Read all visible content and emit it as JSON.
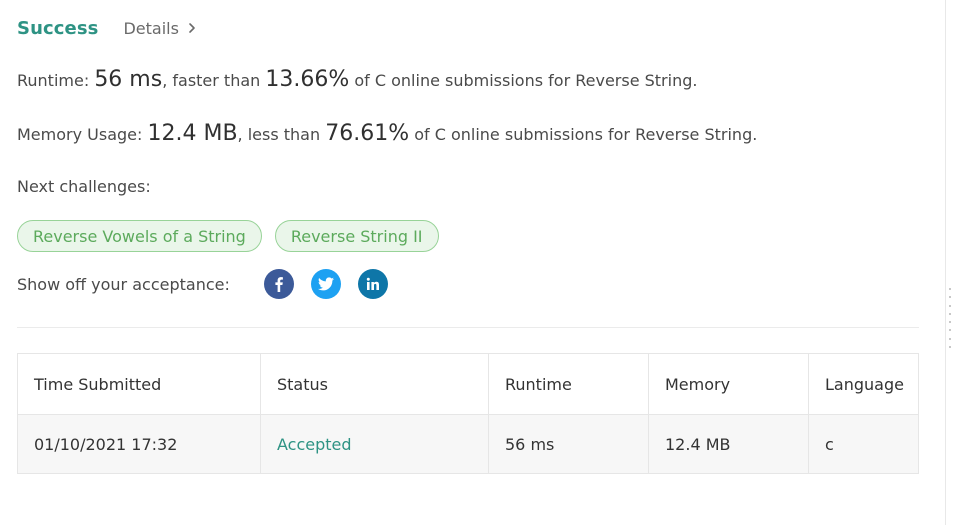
{
  "header": {
    "status": "Success",
    "details_label": "Details"
  },
  "runtime": {
    "prefix": "Runtime: ",
    "value": "56 ms",
    "mid": ", faster than ",
    "percent": "13.66%",
    "suffix": " of C online submissions for Reverse String."
  },
  "memory": {
    "prefix": "Memory Usage: ",
    "value": "12.4 MB",
    "mid": ", less than ",
    "percent": "76.61%",
    "suffix": " of C online submissions for Reverse String."
  },
  "next_challenges": {
    "label": "Next challenges:",
    "items": [
      "Reverse Vowels of a String",
      "Reverse String II"
    ]
  },
  "share": {
    "label": "Show off your acceptance:",
    "icons": [
      "facebook-icon",
      "twitter-icon",
      "linkedin-icon"
    ]
  },
  "table": {
    "headers": [
      "Time Submitted",
      "Status",
      "Runtime",
      "Memory",
      "Language"
    ],
    "rows": [
      [
        "01/10/2021 17:32",
        "Accepted",
        "56 ms",
        "12.4 MB",
        "c"
      ]
    ]
  },
  "colors": {
    "success": "#2e9384",
    "chip_bg": "#eaf6ea",
    "chip_border": "#98d398",
    "chip_text": "#5caa5c",
    "facebook": "#3c5a99",
    "twitter": "#1da1f2",
    "linkedin": "#0e76a8"
  }
}
